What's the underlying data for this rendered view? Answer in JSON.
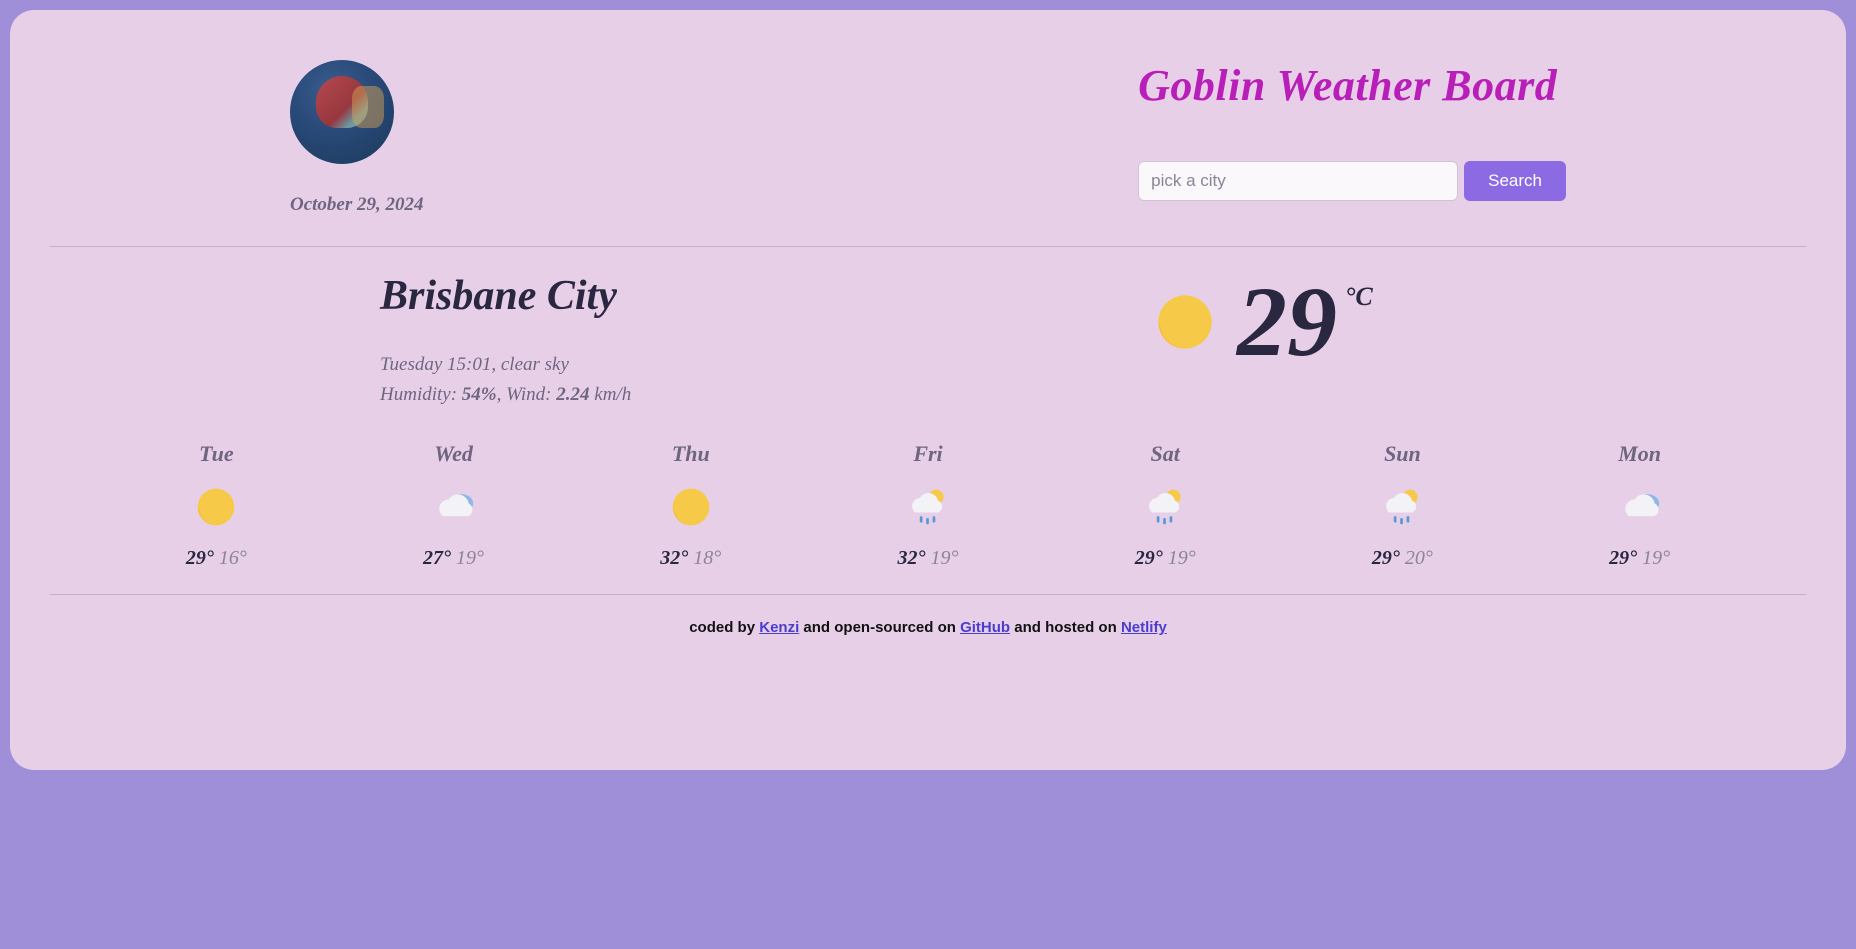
{
  "header": {
    "date": "October 29, 2024",
    "title": "Goblin Weather Board",
    "search_placeholder": "pick a city",
    "search_button": "Search"
  },
  "current": {
    "city": "Brisbane City",
    "time_line_prefix": "Tuesday 15:01, ",
    "condition": "clear sky",
    "humidity_label": "Humidity: ",
    "humidity_value": "54%",
    "wind_label": ", Wind: ",
    "wind_value": "2.24",
    "wind_unit": " km/h",
    "temp": "29",
    "unit": "°C",
    "icon": "sun"
  },
  "forecast": [
    {
      "day": "Tue",
      "icon": "sun",
      "hi": "29°",
      "lo": "16°"
    },
    {
      "day": "Wed",
      "icon": "cloud",
      "hi": "27°",
      "lo": "19°"
    },
    {
      "day": "Thu",
      "icon": "sun",
      "hi": "32°",
      "lo": "18°"
    },
    {
      "day": "Fri",
      "icon": "rain-sun",
      "hi": "32°",
      "lo": "19°"
    },
    {
      "day": "Sat",
      "icon": "rain-sun",
      "hi": "29°",
      "lo": "19°"
    },
    {
      "day": "Sun",
      "icon": "rain-sun",
      "hi": "29°",
      "lo": "20°"
    },
    {
      "day": "Mon",
      "icon": "cloud",
      "hi": "29°",
      "lo": "19°"
    }
  ],
  "footer": {
    "t1": "coded by ",
    "author": "Kenzi",
    "t2": " and open-sourced on ",
    "repo": "GitHub",
    "t3": " and hosted on ",
    "host": "Netlify"
  }
}
